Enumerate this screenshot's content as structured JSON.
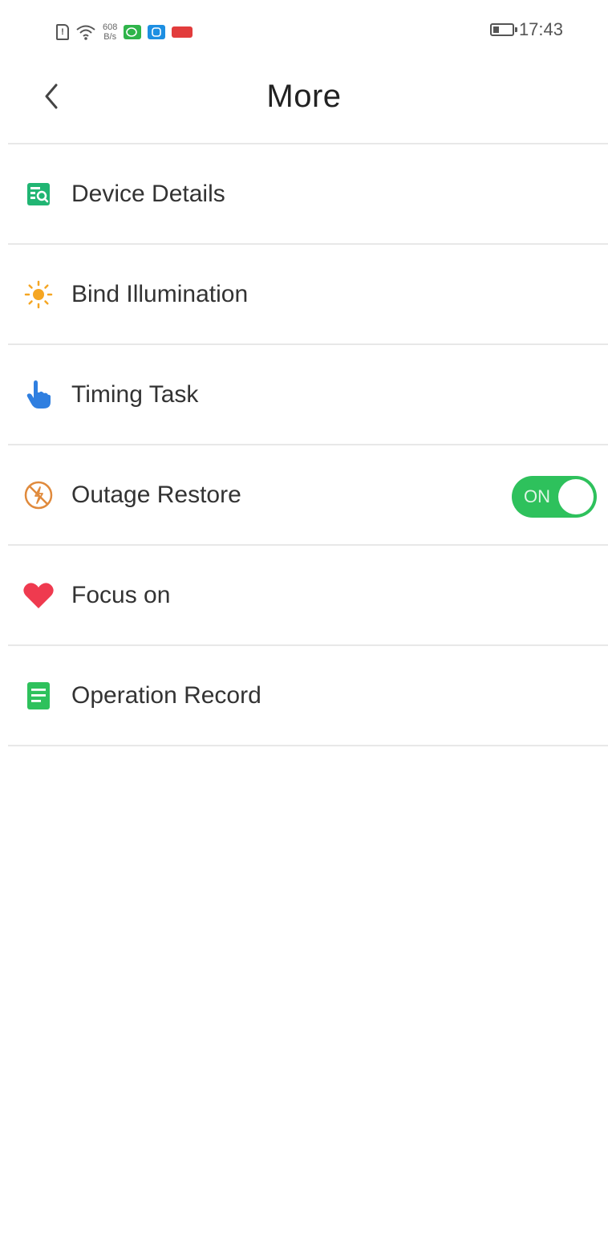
{
  "status_bar": {
    "net_speed_value": "608",
    "net_speed_unit": "B/s",
    "time": "17:43",
    "icons": [
      "sim-icon",
      "wifi-icon",
      "wechat-icon",
      "qq-icon",
      "news-icon",
      "battery-icon"
    ]
  },
  "header": {
    "title": "More",
    "back_icon": "chevron-left-icon"
  },
  "menu": {
    "items": [
      {
        "label": "Device Details",
        "icon": "device-details-icon",
        "icon_color": "#21b573"
      },
      {
        "label": "Bind Illumination",
        "icon": "sun-icon",
        "icon_color": "#f5a623"
      },
      {
        "label": "Timing Task",
        "icon": "pointer-hand-icon",
        "icon_color": "#2f7fe0"
      },
      {
        "label": "Outage Restore",
        "icon": "power-outage-icon",
        "icon_color": "#e08a3c",
        "toggle": {
          "label": "ON",
          "state": true,
          "color": "#2ec15c"
        }
      },
      {
        "label": "Focus on",
        "icon": "heart-icon",
        "icon_color": "#ef3a4f"
      },
      {
        "label": "Operation Record",
        "icon": "record-document-icon",
        "icon_color": "#2ec15c"
      }
    ]
  }
}
